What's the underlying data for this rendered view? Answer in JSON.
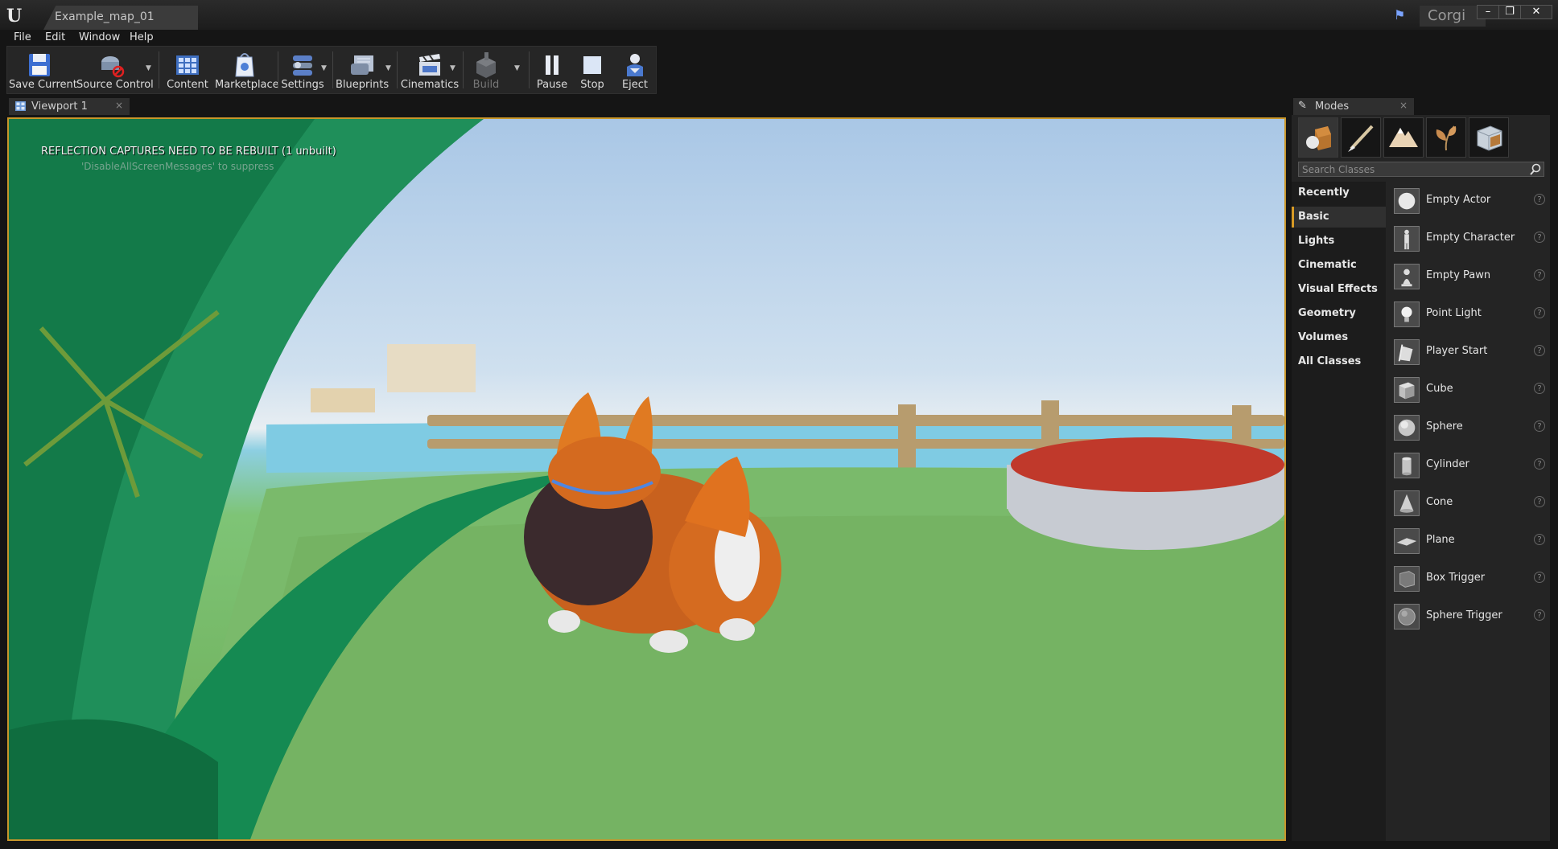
{
  "titlebar": {
    "document_tab": "Example_map_01",
    "project_name": "Corgi",
    "window_buttons": [
      "minimize",
      "restore",
      "close"
    ]
  },
  "menu": [
    "File",
    "Edit",
    "Window",
    "Help"
  ],
  "toolbar": {
    "buttons": [
      {
        "label": "Save Current",
        "icon": "save-icon"
      },
      {
        "label": "Source Control",
        "icon": "source-control-icon"
      },
      {
        "label": "Content",
        "icon": "content-icon"
      },
      {
        "label": "Marketplace",
        "icon": "marketplace-icon"
      },
      {
        "label": "Settings",
        "icon": "settings-icon"
      },
      {
        "label": "Blueprints",
        "icon": "blueprints-icon"
      },
      {
        "label": "Cinematics",
        "icon": "cinematics-icon"
      },
      {
        "label": "Build",
        "icon": "build-icon"
      },
      {
        "label": "Pause",
        "icon": "pause-icon"
      },
      {
        "label": "Stop",
        "icon": "stop-icon"
      },
      {
        "label": "Eject",
        "icon": "eject-icon"
      }
    ]
  },
  "viewport": {
    "tab_label": "Viewport 1",
    "warning": "REFLECTION CAPTURES NEED TO BE REBUILT (1 unbuilt)",
    "warning_hint": "'DisableAllScreenMessages' to suppress"
  },
  "modes": {
    "tab_label": "Modes",
    "mode_icons": [
      "place-mode-icon",
      "paint-mode-icon",
      "landscape-mode-icon",
      "foliage-mode-icon",
      "geometry-mode-icon"
    ],
    "search_placeholder": "Search Classes",
    "categories": [
      "Recently Placed",
      "Basic",
      "Lights",
      "Cinematic",
      "Visual Effects",
      "Geometry",
      "Volumes",
      "All Classes"
    ],
    "active_category": "Basic",
    "items": [
      "Empty Actor",
      "Empty Character",
      "Empty Pawn",
      "Point Light",
      "Player Start",
      "Cube",
      "Sphere",
      "Cylinder",
      "Cone",
      "Plane",
      "Box Trigger",
      "Sphere Trigger"
    ]
  },
  "colors": {
    "accent": "#c8962a",
    "panel_bg": "#242424",
    "chrome_bg": "#151515"
  }
}
